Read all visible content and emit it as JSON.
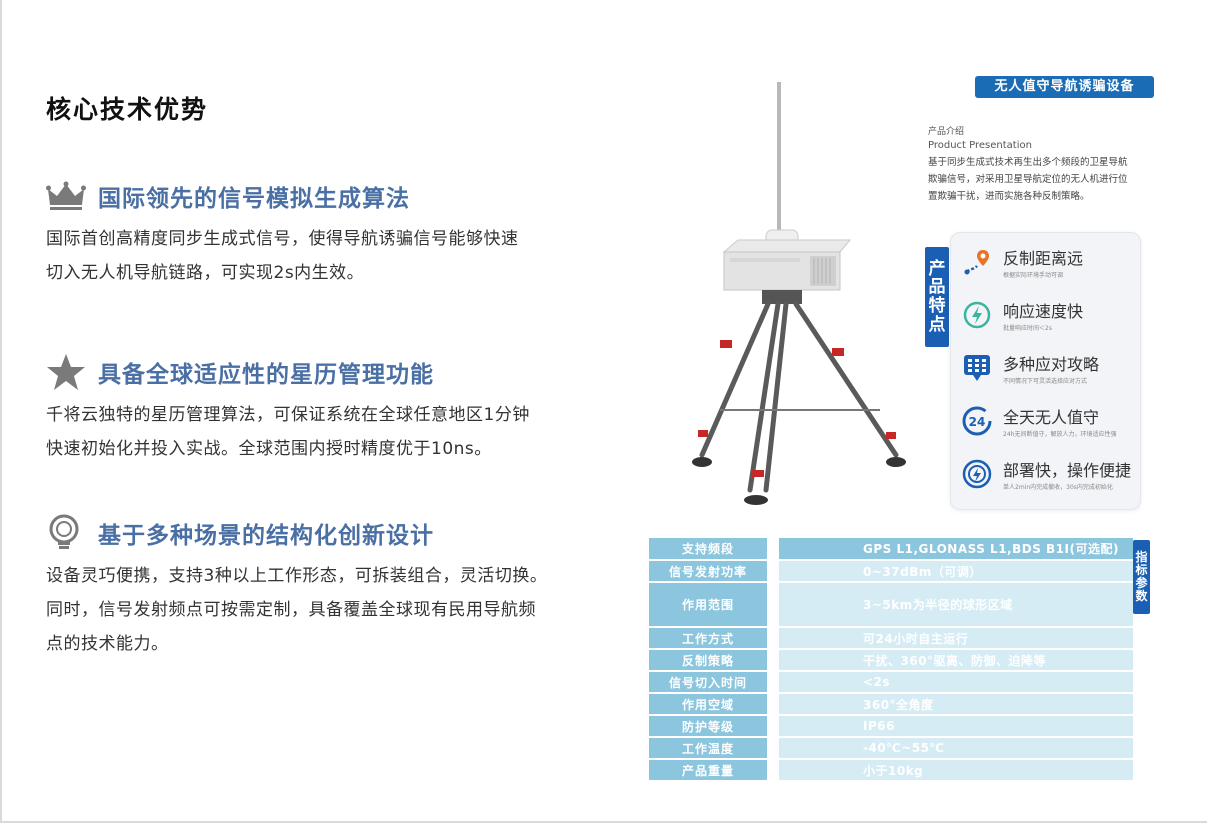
{
  "page": {
    "title": "核心技术优势"
  },
  "features": [
    {
      "icon": "crown-icon",
      "title": "国际领先的信号模拟生成算法",
      "lines": [
        "国际首创高精度同步生成式信号，使得导航诱骗信号能够快速",
        "切入无人机导航链路，可实现2s内生效。"
      ]
    },
    {
      "icon": "star-icon",
      "title": "具备全球适应性的星历管理功能",
      "lines": [
        "千将云独特的星历管理算法，可保证系统在全球任意地区1分钟",
        "快速初始化并投入实战。全球范围内授时精度优于10ns。"
      ]
    },
    {
      "icon": "lightbulb-icon",
      "title": "基于多种场景的结构化创新设计",
      "lines": [
        "设备灵巧便携，支持3种以上工作形态，可拆装组合，灵活切换。",
        "同时，信号发射频点可按需定制，具备覆盖全球现有民用导航频",
        "点的技术能力。"
      ]
    }
  ],
  "product": {
    "badge": "无人值守导航诱骗设备",
    "intro_label_cn": "产品介绍",
    "intro_label_en": "Product Presentation",
    "intro_lines": [
      "基于同步生成式技术再生出多个频段的卫星导航",
      "欺骗信号，对采用卫星导航定位的无人机进行位",
      "置欺骗干扰，进而实施各种反制策略。"
    ]
  },
  "traits_tab": [
    "产",
    "品",
    "特",
    "点"
  ],
  "traits": [
    {
      "icon": "location-pin-icon",
      "title": "反制距离远",
      "sub": "根据实际环境手动可调"
    },
    {
      "icon": "lightning-icon",
      "title": "响应速度快",
      "sub": "批量响应时间＜2s"
    },
    {
      "icon": "grid-phone-icon",
      "title": "多种应对攻略",
      "sub": "不同情况下可灵活选择应对方式"
    },
    {
      "icon": "clock-24-icon",
      "title": "全天无人值守",
      "sub": "24h无间断值守，解放人力，环境适应性强"
    },
    {
      "icon": "fingerprint-icon",
      "title": "部署快，操作便捷",
      "sub": "单人2min内完成撤收，30s内完成初始化"
    }
  ],
  "spec_tab": [
    "指",
    "标",
    "参",
    "数"
  ],
  "specs": [
    {
      "label": "支持频段",
      "value": "GPS L1,GLONASS L1,BDS B1I(可选配)"
    },
    {
      "label": "信号发射功率",
      "value": "0~37dBm（可调）"
    },
    {
      "label": "作用范围",
      "value": "3~5km为半径的球形区域"
    },
    {
      "label": "工作方式",
      "value": "可24小时自主运行"
    },
    {
      "label": "反制策略",
      "value": "干扰、360°驱离、防御、迫降等"
    },
    {
      "label": "信号切入时间",
      "value": "<2s"
    },
    {
      "label": "作用空域",
      "value": "360°全角度"
    },
    {
      "label": "防护等级",
      "value": "IP66"
    },
    {
      "label": "工作温度",
      "value": "-40℃~55℃"
    },
    {
      "label": "产品重量",
      "value": "小于10kg"
    }
  ],
  "colors": {
    "accent": "#1a5fb4",
    "feature_title": "#4a6fa5",
    "spec_label": "#8cc5de",
    "spec_value": "#d5ecf5",
    "icon_gray": "#7a7a7a"
  }
}
